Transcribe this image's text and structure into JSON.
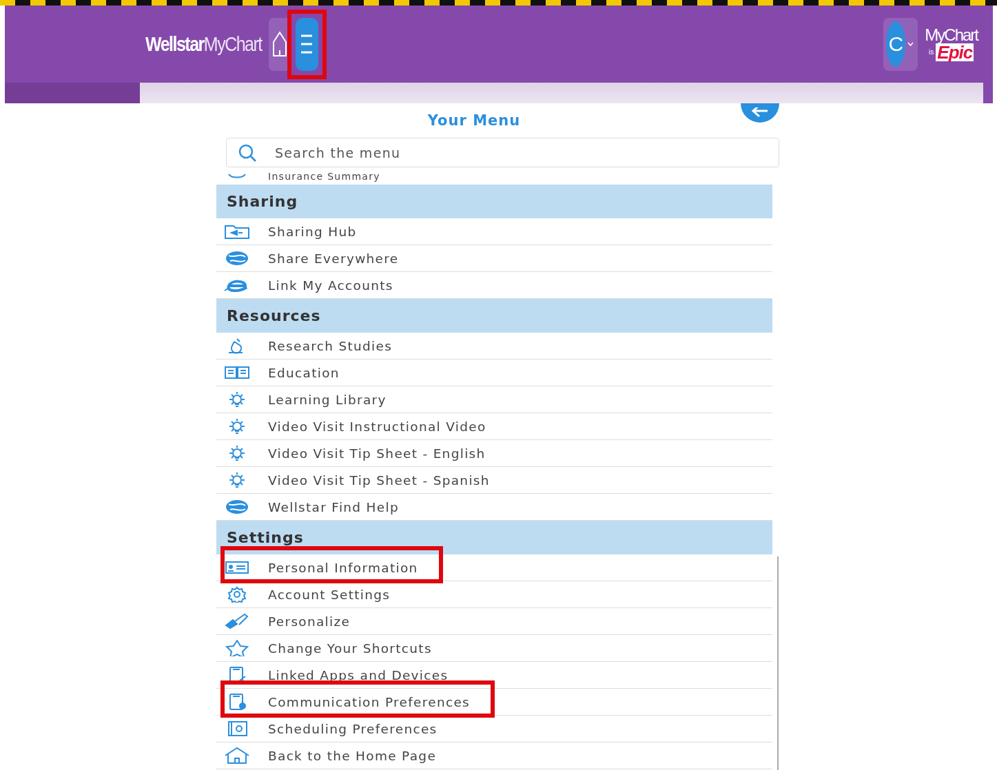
{
  "header": {
    "brand": {
      "bold": "Wellstar",
      "light": "MyChart"
    },
    "menu_button": {
      "annotated": true
    },
    "avatar": {
      "letter": "C"
    },
    "epic_logo": {
      "top": "MyChart",
      "is": "is",
      "bottom": "Epic"
    }
  },
  "menu": {
    "title": "Your Menu",
    "search": {
      "placeholder": "Search the menu"
    },
    "partial_item": {
      "label": "Insurance Summary"
    },
    "sections": [
      {
        "title": "Sharing",
        "items": [
          {
            "label": "Sharing Hub",
            "annotated": false
          },
          {
            "label": "Share Everywhere",
            "annotated": false
          },
          {
            "label": "Link My Accounts",
            "annotated": false
          }
        ]
      },
      {
        "title": "Resources",
        "items": [
          {
            "label": "Research Studies",
            "annotated": false
          },
          {
            "label": "Education",
            "annotated": false
          },
          {
            "label": "Learning Library",
            "annotated": false
          },
          {
            "label": "Video Visit Instructional Video",
            "annotated": false
          },
          {
            "label": "Video Visit Tip Sheet - English",
            "annotated": false
          },
          {
            "label": "Video Visit Tip Sheet - Spanish",
            "annotated": false
          },
          {
            "label": "Wellstar Find Help",
            "annotated": false
          }
        ]
      },
      {
        "title": "Settings",
        "items": [
          {
            "label": "Personal Information",
            "annotated": true
          },
          {
            "label": "Account Settings",
            "annotated": false
          },
          {
            "label": "Personalize",
            "annotated": false
          },
          {
            "label": "Change Your Shortcuts",
            "annotated": false
          },
          {
            "label": "Linked Apps and Devices",
            "annotated": false
          },
          {
            "label": "Communication Preferences",
            "annotated": true
          },
          {
            "label": "Scheduling Preferences",
            "annotated": false
          },
          {
            "label": "Back to the Home Page",
            "annotated": false
          }
        ]
      }
    ]
  }
}
